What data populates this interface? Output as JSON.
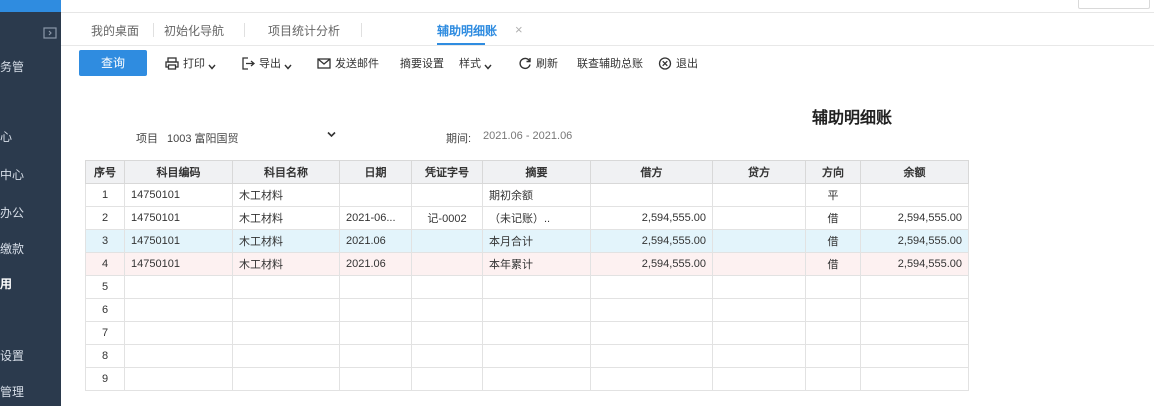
{
  "sidebar": {
    "items": [
      "务管",
      "",
      "心",
      "中心",
      "办公",
      "缴款",
      "用",
      "",
      "设置",
      "管理"
    ],
    "active_index": 6
  },
  "tabs": [
    {
      "label": "我的桌面"
    },
    {
      "label": "初始化导航"
    },
    {
      "label": "项目统计分析"
    },
    {
      "label": "辅助明细账",
      "active": true,
      "close": "×"
    }
  ],
  "toolbar": {
    "query": "查询",
    "print": "打印",
    "export": "导出",
    "send_mail": "发送邮件",
    "summary_settings": "摘要设置",
    "style": "样式",
    "refresh": "刷新",
    "link_aux_summary": "联查辅助总账",
    "exit": "退出"
  },
  "report": {
    "title": "辅助明细账",
    "project_label": "项目",
    "project_value": "1003 富阳国贸",
    "period_label": "期间:",
    "period_value": "2021.06 - 2021.06"
  },
  "table": {
    "headers": [
      "序号",
      "科目编码",
      "科目名称",
      "日期",
      "凭证字号",
      "摘要",
      "借方",
      "贷方",
      "方向",
      "余额"
    ],
    "rows": [
      {
        "no": "1",
        "code": "14750101",
        "name": "木工材料",
        "date": "",
        "voucher": "",
        "summary": "期初余额",
        "debit": "",
        "credit": "",
        "dir": "平",
        "balance": ""
      },
      {
        "no": "2",
        "code": "14750101",
        "name": "木工材料",
        "date": "2021-06...",
        "voucher": "记-0002",
        "summary": "（未记账）..",
        "debit": "2,594,555.00",
        "credit": "",
        "dir": "借",
        "balance": "2,594,555.00"
      },
      {
        "no": "3",
        "code": "14750101",
        "name": "木工材料",
        "date": "2021.06",
        "voucher": "",
        "summary": "本月合计",
        "debit": "2,594,555.00",
        "credit": "",
        "dir": "借",
        "balance": "2,594,555.00"
      },
      {
        "no": "4",
        "code": "14750101",
        "name": "木工材料",
        "date": "2021.06",
        "voucher": "",
        "summary": "本年累计",
        "debit": "2,594,555.00",
        "credit": "",
        "dir": "借",
        "balance": "2,594,555.00"
      },
      {
        "no": "5",
        "code": "",
        "name": "",
        "date": "",
        "voucher": "",
        "summary": "",
        "debit": "",
        "credit": "",
        "dir": "",
        "balance": ""
      },
      {
        "no": "6",
        "code": "",
        "name": "",
        "date": "",
        "voucher": "",
        "summary": "",
        "debit": "",
        "credit": "",
        "dir": "",
        "balance": ""
      },
      {
        "no": "7",
        "code": "",
        "name": "",
        "date": "",
        "voucher": "",
        "summary": "",
        "debit": "",
        "credit": "",
        "dir": "",
        "balance": ""
      },
      {
        "no": "8",
        "code": "",
        "name": "",
        "date": "",
        "voucher": "",
        "summary": "",
        "debit": "",
        "credit": "",
        "dir": "",
        "balance": ""
      },
      {
        "no": "9",
        "code": "",
        "name": "",
        "date": "",
        "voucher": "",
        "summary": "",
        "debit": "",
        "credit": "",
        "dir": "",
        "balance": ""
      }
    ]
  },
  "colors": {
    "accent": "#2f8ce0",
    "sidebar": "#2b3a4d",
    "selected_row": "#e3f4fb",
    "pink_row": "#fdf1f1"
  }
}
